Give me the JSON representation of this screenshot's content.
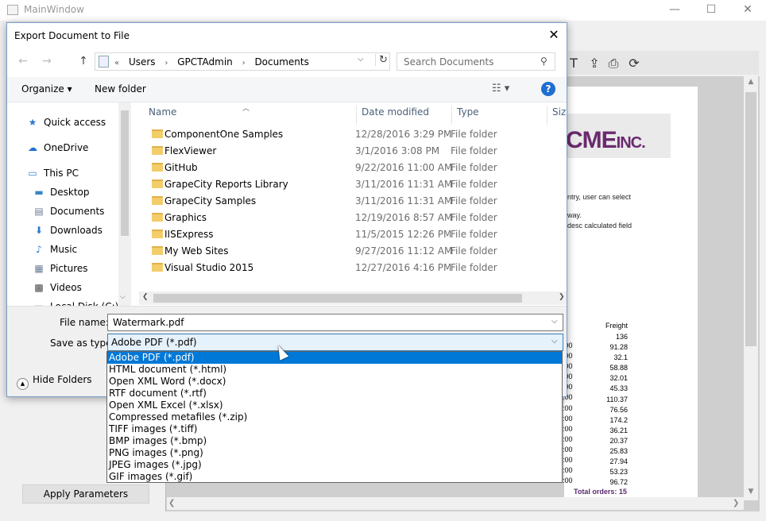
{
  "main_window": {
    "title": "MainWindow",
    "controls": {
      "minimize": "—",
      "maximize": "☐",
      "close": "✕"
    },
    "toolbar_icons": [
      "text-icon",
      "export-icon",
      "print-icon",
      "refresh-icon"
    ],
    "report": {
      "logo_main": "CME",
      "logo_suffix": "INC.",
      "lines": [
        "ntry, user can select",
        "way.",
        "desc calculated field"
      ],
      "freight_header": "Freight",
      "freight_values": [
        "136",
        "91.28",
        "32.1",
        "58.88",
        "32.01",
        "45.33",
        "110.37",
        "76.56",
        "174.2",
        "36.21",
        "20.37",
        "25.83",
        "27.94",
        "53.23",
        "96.72"
      ],
      "time_stubs": [
        ":00",
        ":00",
        ":00",
        ":00",
        ":00",
        ":00",
        ":00",
        ":00",
        ":00",
        ":00",
        ":00",
        ":00",
        ":00",
        ":00"
      ],
      "total_orders": "Total orders: 15"
    },
    "apply_parameters": "Apply Parameters"
  },
  "dialog": {
    "title": "Export Document to File",
    "close": "✕",
    "address": {
      "crumbs": [
        "Users",
        "GPCTAdmin",
        "Documents"
      ],
      "prefix": "«"
    },
    "search": {
      "placeholder": "Search Documents"
    },
    "commands": {
      "organize": "Organize ▾",
      "new_folder": "New folder",
      "help": "?"
    },
    "nav": [
      {
        "label": "Quick access",
        "icon": "star-icon",
        "color": "#2b79d0"
      },
      {
        "label": "OneDrive",
        "icon": "cloud-icon",
        "color": "#1e6fd0"
      },
      {
        "label": "This PC",
        "icon": "computer-icon",
        "color": "#3a86c8"
      },
      {
        "label": "Desktop",
        "icon": "desktop-icon",
        "color": "#3a86c8"
      },
      {
        "label": "Documents",
        "icon": "document-icon",
        "color": "#6a7c94"
      },
      {
        "label": "Downloads",
        "icon": "download-icon",
        "color": "#2b79d0"
      },
      {
        "label": "Music",
        "icon": "music-icon",
        "color": "#2b79d0"
      },
      {
        "label": "Pictures",
        "icon": "picture-icon",
        "color": "#6a7c94"
      },
      {
        "label": "Videos",
        "icon": "video-icon",
        "color": "#444444"
      },
      {
        "label": "Local Disk (C:)",
        "icon": "disk-icon",
        "color": "#6a7c94"
      }
    ],
    "columns": {
      "name": "Name",
      "date": "Date modified",
      "type": "Type",
      "size": "Size"
    },
    "files": [
      {
        "name": "ComponentOne Samples",
        "date": "12/28/2016 3:29 PM",
        "type": "File folder"
      },
      {
        "name": "FlexViewer",
        "date": "3/1/2016 3:08 PM",
        "type": "File folder"
      },
      {
        "name": "GitHub",
        "date": "9/22/2016 11:00 AM",
        "type": "File folder"
      },
      {
        "name": "GrapeCity Reports Library",
        "date": "3/11/2016 11:31 AM",
        "type": "File folder"
      },
      {
        "name": "GrapeCity Samples",
        "date": "3/11/2016 11:31 AM",
        "type": "File folder"
      },
      {
        "name": "Graphics",
        "date": "12/19/2016 8:57 AM",
        "type": "File folder"
      },
      {
        "name": "IISExpress",
        "date": "11/5/2015 12:26 PM",
        "type": "File folder"
      },
      {
        "name": "My Web Sites",
        "date": "9/27/2016 11:12 AM",
        "type": "File folder"
      },
      {
        "name": "Visual Studio 2015",
        "date": "12/27/2016 4:16 PM",
        "type": "File folder"
      }
    ],
    "file_name_label": "File name:",
    "file_name_value": "Watermark.pdf",
    "save_type_label": "Save as type:",
    "save_type_value": "Adobe PDF (*.pdf)",
    "hide_folders": "Hide Folders",
    "type_options": [
      "Adobe PDF (*.pdf)",
      "HTML document (*.html)",
      "Open XML Word (*.docx)",
      "RTF document (*.rtf)",
      "Open XML Excel (*.xlsx)",
      "Compressed metafiles (*.zip)",
      "TIFF images (*.tiff)",
      "BMP images (*.bmp)",
      "PNG images (*.png)",
      "JPEG images (*.jpg)",
      "GIF images (*.gif)"
    ],
    "selected_type_index": 0
  }
}
